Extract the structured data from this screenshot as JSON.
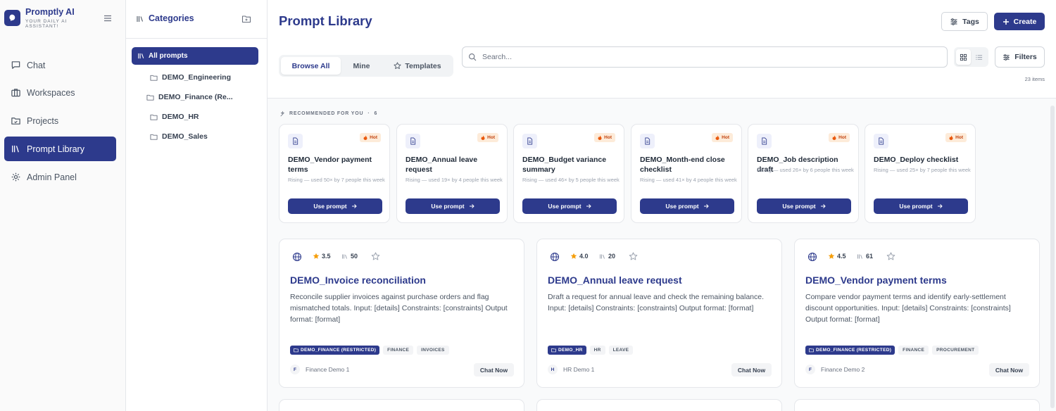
{
  "brand": {
    "name": "Promptly AI",
    "tagline": "YOUR DAILY AI ASSISTANT!",
    "accent": "#2d3a8c"
  },
  "nav": [
    {
      "label": "Chat",
      "icon": "chat-icon",
      "active": false
    },
    {
      "label": "Workspaces",
      "icon": "briefcase-icon",
      "active": false
    },
    {
      "label": "Projects",
      "icon": "folder-icon",
      "active": false
    },
    {
      "label": "Prompt Library",
      "icon": "library-icon",
      "active": true
    },
    {
      "label": "Admin Panel",
      "icon": "gear-icon",
      "active": false
    }
  ],
  "categories": {
    "title": "Categories",
    "all_label": "All prompts",
    "items": [
      "DEMO_Engineering",
      "DEMO_Finance (Re...",
      "DEMO_HR",
      "DEMO_Sales"
    ]
  },
  "header": {
    "title": "Prompt Library",
    "tags_label": "Tags",
    "create_label": "Create",
    "filters_label": "Filters",
    "item_count": "23 items"
  },
  "tabs": [
    {
      "label": "Browse All",
      "active": true
    },
    {
      "label": "Mine",
      "active": false
    },
    {
      "label": "Templates",
      "active": false
    }
  ],
  "search": {
    "placeholder": "Search...",
    "value": ""
  },
  "recommended": {
    "label": "RECOMMENDED FOR YOU",
    "count": "6",
    "hot_label": "Hot",
    "button_label": "Use prompt",
    "cards": [
      {
        "title": "DEMO_Vendor payment terms",
        "meta": "Rising — used 50× by 7 people this week"
      },
      {
        "title": "DEMO_Annual leave request",
        "meta": "Rising — used 19× by 4 people this week"
      },
      {
        "title": "DEMO_Budget variance summary",
        "meta": "Rising — used 46× by 5 people this week"
      },
      {
        "title": "DEMO_Month-end close checklist",
        "meta": "Rising — used 41× by 4 people this week"
      },
      {
        "title": "DEMO_Job description draft",
        "meta": "Rising — used 26× by 6 people this week"
      },
      {
        "title": "DEMO_Deploy checklist",
        "meta": "Rising — used 25× by 7 people this week"
      }
    ]
  },
  "prompts": {
    "chat_label": "Chat Now",
    "cards": [
      {
        "rating": "3.5",
        "uses": "50",
        "title": "DEMO_Invoice reconciliation",
        "description": "Reconcile supplier invoices against purchase orders and flag mismatched totals. Input: [details] Constraints: [constraints] Output format: [format]",
        "category": "DEMO_FINANCE (RESTRICTED)",
        "tags": [
          "FINANCE",
          "INVOICES"
        ],
        "author_initial": "F",
        "author": "Finance Demo 1"
      },
      {
        "rating": "4.0",
        "uses": "20",
        "title": "DEMO_Annual leave request",
        "description": "Draft a request for annual leave and check the remaining balance. Input: [details] Constraints: [constraints] Output format: [format]",
        "category": "DEMO_HR",
        "tags": [
          "HR",
          "LEAVE"
        ],
        "author_initial": "H",
        "author": "HR Demo 1"
      },
      {
        "rating": "4.5",
        "uses": "61",
        "title": "DEMO_Vendor payment terms",
        "description": "Compare vendor payment terms and identify early-settlement discount opportunities. Input: [details] Constraints: [constraints] Output format: [format]",
        "category": "DEMO_FINANCE (RESTRICTED)",
        "tags": [
          "FINANCE",
          "PROCUREMENT"
        ],
        "author_initial": "F",
        "author": "Finance Demo 2"
      }
    ]
  }
}
